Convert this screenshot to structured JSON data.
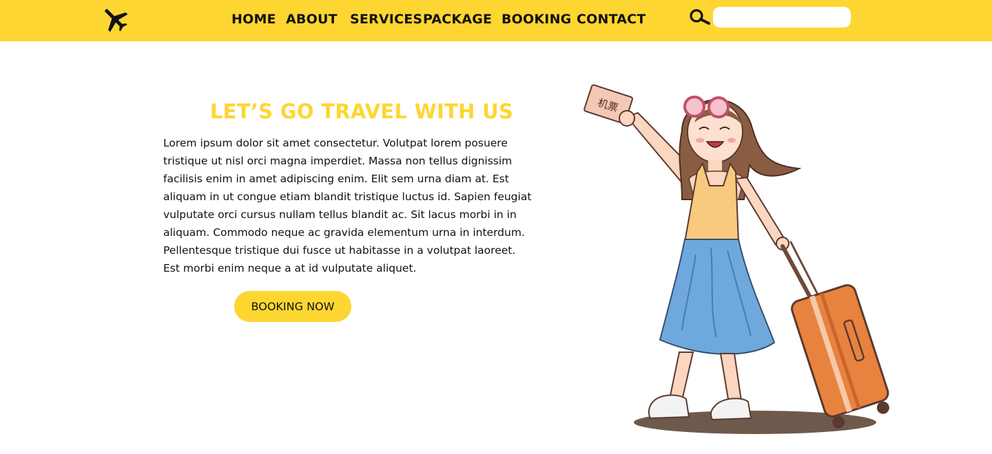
{
  "colors": {
    "accent": "#fed631",
    "text": "#111111",
    "background": "#ffffff"
  },
  "header": {
    "logo_icon": "airplane-icon",
    "nav": [
      "HOME",
      "ABOUT",
      "SERVICES",
      "PACKAGE",
      "BOOKING",
      "CONTACT"
    ],
    "search_icon": "search-icon",
    "search": {
      "value": "",
      "placeholder": ""
    }
  },
  "hero": {
    "title": "LET’S GO TRAVEL WITH US",
    "body": "Lorem ipsum dolor sit amet consectetur. Volutpat lorem posuere tristique ut nisl orci magna imperdiet. Massa non tellus dignissim facilisis enim in amet adipiscing enim. Elit sem urna diam at. Est aliquam in ut congue etiam blandit tristique luctus id. Sapien feugiat vulputate orci cursus nullam tellus blandit ac. Sit lacus morbi in in aliquam. Commodo neque ac gravida elementum urna in interdum. Pellentesque tristique dui fusce ut habitasse in a volutpat laoreet. Est morbi enim neque a at id vulputate aliquet.",
    "cta_label": "BOOKING NOW",
    "illustration_icon": "traveler-girl-with-suitcase-illustration",
    "ticket_text": "机票"
  }
}
